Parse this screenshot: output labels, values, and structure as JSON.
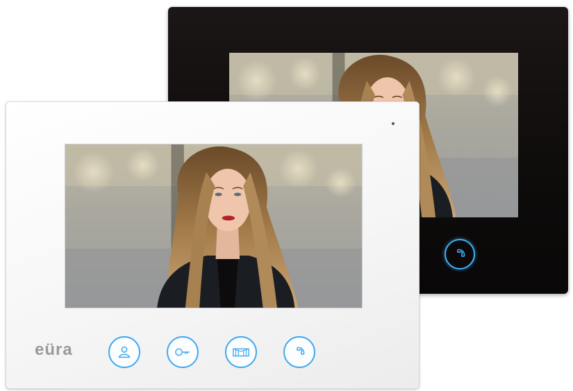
{
  "brand": {
    "logo_text": "eüra"
  },
  "colors": {
    "accent": "#3fa9f0",
    "black_body": "#0e0b0b",
    "white_body": "#f6f6f6",
    "logo_gray": "#9a9a9a"
  },
  "white_monitor": {
    "buttons": [
      {
        "icon": "user-icon"
      },
      {
        "icon": "key-icon"
      },
      {
        "icon": "gate-icon"
      },
      {
        "icon": "phone-handset-icon"
      }
    ]
  },
  "black_monitor": {
    "buttons": [
      {
        "icon": "phone-handset-icon"
      }
    ]
  },
  "screen_content": "woman-portrait"
}
